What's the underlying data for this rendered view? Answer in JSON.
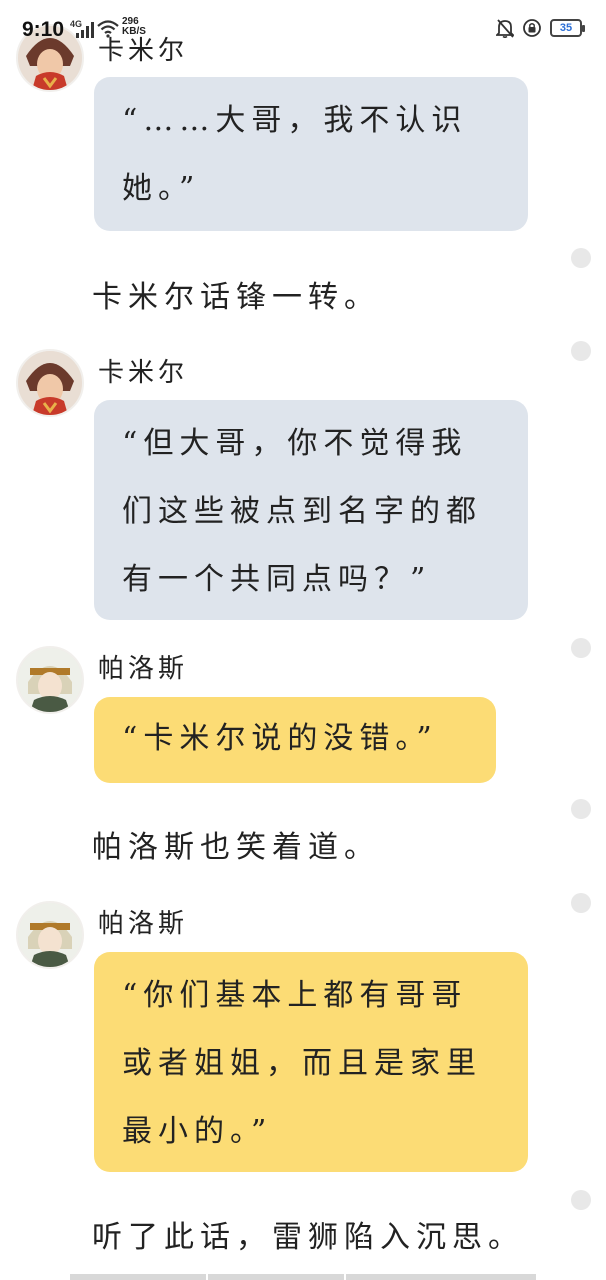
{
  "status_bar": {
    "time": "9:10",
    "network": "4G",
    "speed_value": "296",
    "speed_unit": "KB/S",
    "battery": "35",
    "icons": [
      "signal-icon",
      "wifi-icon",
      "bell-muted-icon",
      "alarm-lock-icon",
      "battery-icon"
    ],
    "battery_color": "#2c6fd6"
  },
  "colors": {
    "bubble_blue": "#dee4ec",
    "bubble_yellow": "#fcdc75",
    "text": "#222222"
  },
  "chat": {
    "msg1": {
      "speaker": "卡米尔",
      "text": "“……大哥，我不认识她。”"
    },
    "narration1": "卡米尔话锋一转。",
    "msg2": {
      "speaker": "卡米尔",
      "text": "“但大哥，你不觉得我们这些被点到名字的都有一个共同点吗？”"
    },
    "msg3": {
      "speaker": "帕洛斯",
      "text": "“卡米尔说的没错。”"
    },
    "narration2": "帕洛斯也笑着道。",
    "msg4": {
      "speaker": "帕洛斯",
      "text": "“你们基本上都有哥哥或者姐姐，而且是家里最小的。”"
    },
    "narration3": "听了此话，雷狮陷入沉思。"
  }
}
